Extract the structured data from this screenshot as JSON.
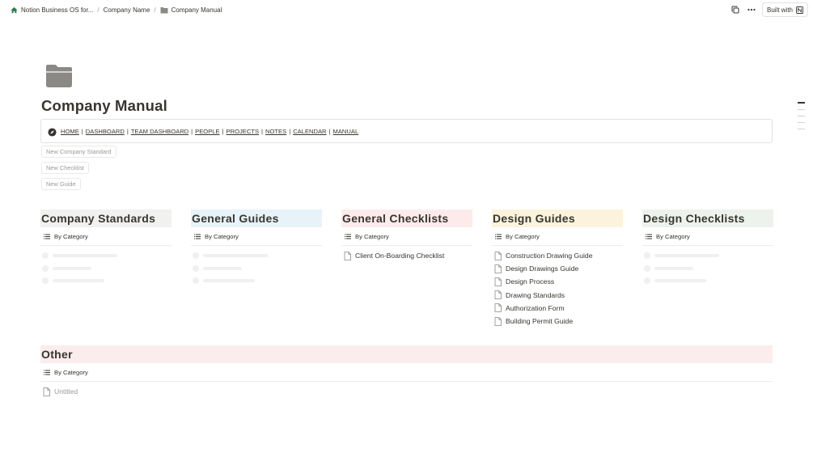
{
  "breadcrumb": [
    {
      "label": "Notion Business OS for...",
      "icon": "home-icon"
    },
    {
      "label": "Company Name",
      "icon": ""
    },
    {
      "label": "Company Manual",
      "icon": "folder-icon"
    }
  ],
  "topbar": {
    "built_label": "Built with"
  },
  "page": {
    "title": "Company Manual",
    "icon": "folder-icon"
  },
  "nav": {
    "links": [
      "HOME",
      "DASHBOARD",
      "TEAM DASHBOARD",
      "PEOPLE",
      "PROJECTS",
      "NOTES",
      "CALENDAR",
      "MANUAL"
    ],
    "separator": "|"
  },
  "buttons": {
    "new_company_standard": "New Company Standard",
    "new_checklist": "New Checklist",
    "new_guide": "New Guide"
  },
  "columns": [
    {
      "title": "Company Standards",
      "view": "By Category",
      "color": "#f1f1ef",
      "items": []
    },
    {
      "title": "General Guides",
      "view": "By Category",
      "color": "#e7f3f8",
      "items": []
    },
    {
      "title": "General Checklists",
      "view": "By Category",
      "color": "#fdebec",
      "items": [
        "Client On-Boarding Checklist"
      ]
    },
    {
      "title": "Design Guides",
      "view": "By Category",
      "color": "#fbf3db",
      "items": [
        "Construction Drawing Guide",
        "Design Drawings Guide",
        "Design Process",
        "Drawing Standards",
        "Authorization Form",
        "Building Permit Guide"
      ]
    },
    {
      "title": "Design Checklists",
      "view": "By Category",
      "color": "#edf3ec",
      "items": []
    }
  ],
  "other": {
    "title": "Other",
    "view": "By Category",
    "items": [
      "Untitled"
    ]
  }
}
